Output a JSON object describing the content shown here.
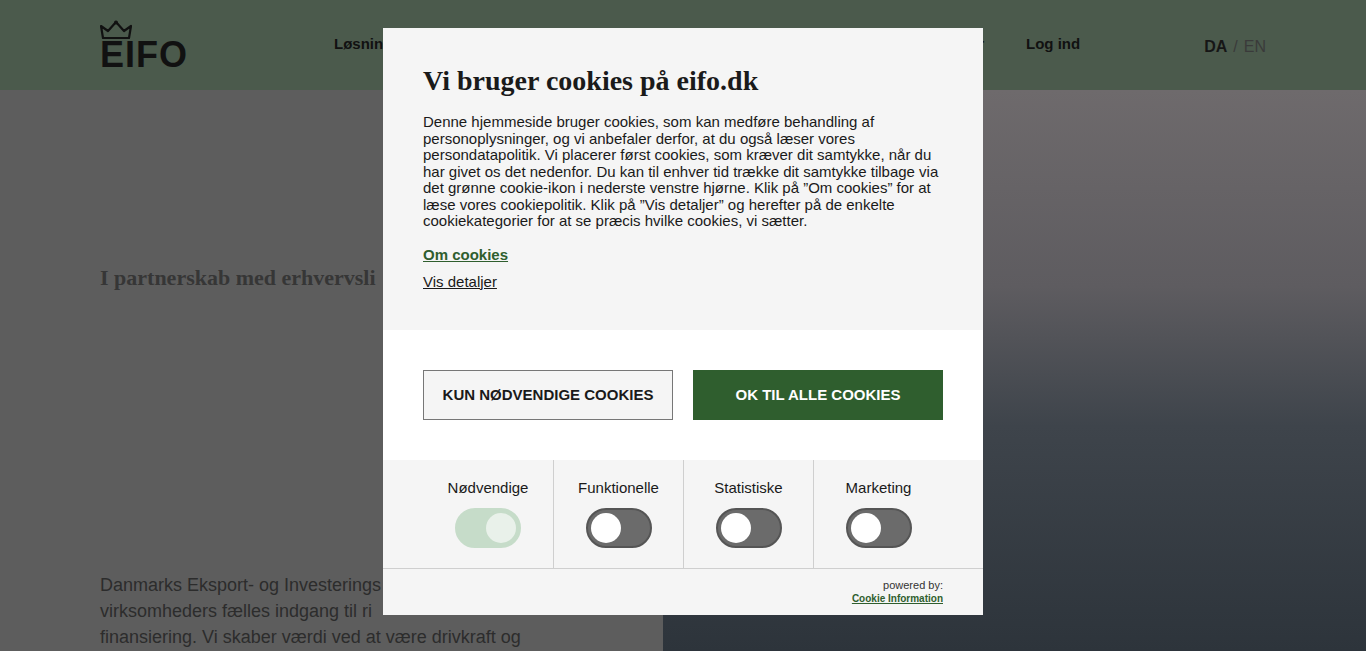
{
  "header": {
    "logo": "EIFO",
    "nav": [
      {
        "label": "Løsnin"
      },
      {
        "label": "r"
      },
      {
        "label": "Log ind"
      }
    ],
    "languages": [
      {
        "label": "DA",
        "selected": true
      },
      {
        "label": "EN",
        "selected": false
      }
    ],
    "language_separator": "/"
  },
  "hero": {
    "title": "I partnerskab med erhvervsli",
    "paragraph": [
      "Danmarks Eksport- og Investerings",
      "virksomheders fælles indgang til ri",
      "finansiering. Vi skaber værdi ved at være drivkraft og"
    ]
  },
  "cookie_dialog": {
    "title": "Vi bruger cookies på eifo.dk",
    "body": "Denne hjemmeside bruger cookies, som kan medføre behandling af personoplysninger, og vi anbefaler derfor, at du også læser vores persondatapolitik. Vi placerer først cookies, som kræver dit samtykke, når du har givet os det nedenfor. Du kan til enhver tid trække dit samtykke tilbage via det grønne cookie-ikon i nederste venstre hjørne. Klik på ”Om cookies” for at læse vores cookiepolitik. Klik på ”Vis detaljer” og herefter på de enkelte cookiekategorier for at se præcis hvilke cookies, vi sætter.",
    "links": [
      {
        "label": "Om cookies",
        "kind": "primary"
      },
      {
        "label": "Vis detaljer",
        "kind": "secondary"
      }
    ],
    "buttons": [
      {
        "label": "KUN NØDVENDIGE COOKIES",
        "kind": "outline"
      },
      {
        "label": "OK TIL ALLE COOKIES",
        "kind": "filled"
      }
    ],
    "categories": [
      {
        "label": "Nødvendige",
        "on": true,
        "disabled": true
      },
      {
        "label": "Funktionelle",
        "on": false,
        "disabled": false
      },
      {
        "label": "Statistiske",
        "on": false,
        "disabled": false
      },
      {
        "label": "Marketing",
        "on": false,
        "disabled": false
      }
    ],
    "powered_by": "powered by:",
    "provider": "Cookie Information"
  }
}
